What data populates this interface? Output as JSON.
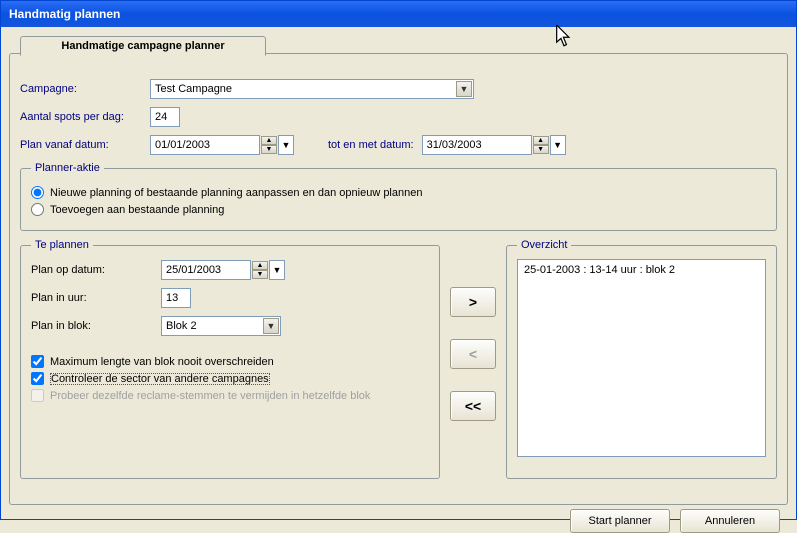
{
  "window": {
    "title": "Handmatig plannen"
  },
  "tab": {
    "label": "Handmatige campagne planner"
  },
  "labels": {
    "campaign": "Campagne:",
    "spots_per_day": "Aantal spots per dag:",
    "plan_from": "Plan vanaf datum:",
    "plan_to": "tot en met datum:"
  },
  "fields": {
    "campaign": "Test Campagne",
    "spots_per_day": "24",
    "plan_from": "01/01/2003",
    "plan_to": "31/03/2003"
  },
  "planner_action": {
    "legend": "Planner-aktie",
    "opt_new": "Nieuwe planning of bestaande planning aanpassen en dan opnieuw plannen",
    "opt_append": "Toevoegen aan bestaande planning"
  },
  "te_plannen": {
    "legend": "Te plannen",
    "plan_date_label": "Plan op datum:",
    "plan_date": "25/01/2003",
    "plan_hour_label": "Plan in uur:",
    "plan_hour": "13",
    "plan_block_label": "Plan in blok:",
    "plan_block": "Blok 2",
    "chk_max": "Maximum lengte van blok nooit overschreiden",
    "chk_sector": "Controleer de sector van andere campagnes",
    "chk_voice": "Probeer dezelfde reclame-stemmen te vermijden in hetzelfde blok"
  },
  "mid": {
    "add": ">",
    "remove": "<",
    "clear": "<<"
  },
  "overzicht": {
    "legend": "Overzicht",
    "items": [
      "25-01-2003 : 13-14 uur : blok 2"
    ]
  },
  "buttons": {
    "start": "Start planner",
    "cancel": "Annuleren"
  }
}
